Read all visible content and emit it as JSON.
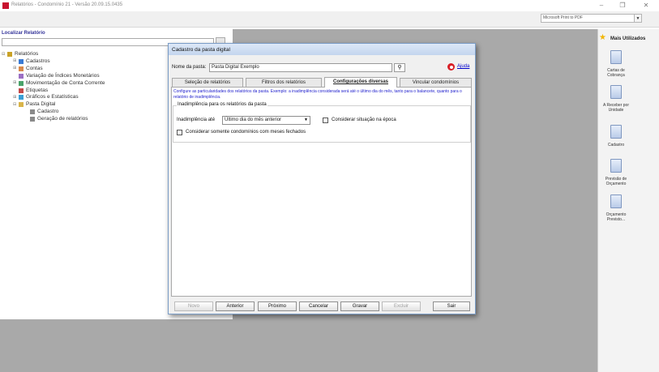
{
  "window": {
    "title": "Relatórios - Condomínio 21 - Versão 20.09.15.0435",
    "minimize": "–",
    "maximize": "❐",
    "close": "✕"
  },
  "toolbar": {
    "printer": "Microsoft Print to PDF",
    "printer_arrow": "▼"
  },
  "left_panel": {
    "title": "Localizar Relatório",
    "search_value": "",
    "tree": [
      {
        "label": "Relatórios",
        "expander": "⊟",
        "indent": 0
      },
      {
        "label": "Cadastros",
        "expander": "⊞",
        "indent": 1
      },
      {
        "label": "Contas",
        "expander": "⊞",
        "indent": 1
      },
      {
        "label": "Variação de Índices Monetários",
        "expander": "",
        "indent": 1
      },
      {
        "label": "Movimentação de Conta Corrente",
        "expander": "⊞",
        "indent": 1
      },
      {
        "label": "Etiquetas",
        "expander": "",
        "indent": 1
      },
      {
        "label": "Gráficos e Estatísticas",
        "expander": "⊞",
        "indent": 1
      },
      {
        "label": "Pasta Digital",
        "expander": "⊟",
        "indent": 1
      },
      {
        "label": "Cadastro",
        "expander": "",
        "indent": 2
      },
      {
        "label": "Geração de relatórios",
        "expander": "",
        "indent": 2
      }
    ]
  },
  "right_panel": {
    "title": "Mais Utilizados",
    "shortcuts": [
      {
        "label": "Cartas de Cobrança"
      },
      {
        "label": "A Receber por Unidade"
      },
      {
        "label": "Cadastro"
      },
      {
        "label": "Previsão de Orçamento"
      },
      {
        "label": "Orçamento Previsto..."
      }
    ]
  },
  "dialog": {
    "title": "Cadastro da pasta digital",
    "name_label": "Nome da pasta:",
    "name_value": "Pasta Digital Exemplo",
    "search_glyph": "⚲",
    "help_label": "Ajuda",
    "tabs": [
      {
        "label": "Seleção de relatórios",
        "active": false
      },
      {
        "label": "Filtros dos relatórios",
        "active": false
      },
      {
        "label": "Configurações diversas",
        "active": true
      },
      {
        "label": "Vincular condomínios",
        "active": false
      }
    ],
    "description": "Configure as particularidades dos relatórios da pasta. Exemplo: a inadimplência considerada será até o último dia do mês, tanto para o balancete, quanto para o relatório de inadimplência.",
    "group_title": "Inadimplência para os relatórios da pasta",
    "inad_label": "Inadimplência até",
    "inad_value": "Último dia do mês anterior",
    "inad_arrow": "▼",
    "consider_epoch_label": "Considerar situação na época",
    "consider_epoch_checked": false,
    "closed_months_label": "Considerar somente condomínios com meses fechados",
    "closed_months_checked": false,
    "buttons": [
      {
        "label": "Novo",
        "enabled": false
      },
      {
        "label": "Anterior",
        "enabled": true
      },
      {
        "label": "Próximo",
        "enabled": true
      },
      {
        "label": "Cancelar",
        "enabled": true
      },
      {
        "label": "Gravar",
        "enabled": true
      },
      {
        "label": "Excluir",
        "enabled": false
      },
      {
        "label": "Sair",
        "enabled": true
      }
    ]
  },
  "colors": {
    "accent_red": "#c8102e",
    "link_blue": "#0000cc",
    "description_blue": "#1c1ccc",
    "workspace_gray": "#a9a9a9"
  }
}
